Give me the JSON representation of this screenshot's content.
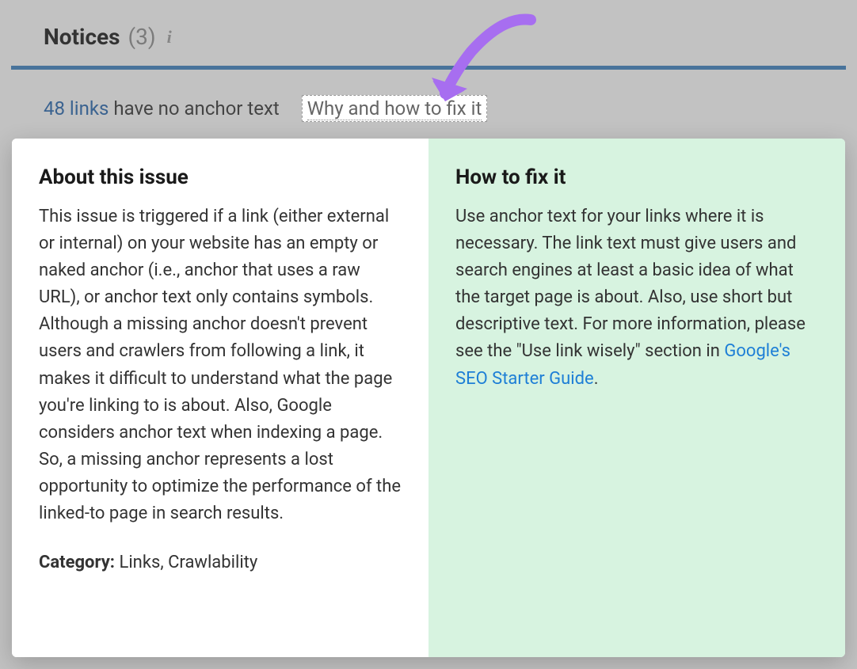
{
  "notices": {
    "title": "Notices",
    "count": "(3)"
  },
  "issue": {
    "link_text": "48 links",
    "suffix_text": " have no anchor text",
    "fixit_label": "Why and how to fix it"
  },
  "popup": {
    "about": {
      "heading": "About this issue",
      "body": "This issue is triggered if a link (either external or internal) on your website has an empty or naked anchor (i.e., anchor that uses a raw URL), or anchor text only contains symbols. Although a missing anchor doesn't prevent users and crawlers from following a link, it makes it difficult to understand what the page you're linking to is about. Also, Google considers anchor text when indexing a page. So, a missing anchor represents a lost opportunity to optimize the performance of the linked-to page in search results.",
      "category_label": "Category:",
      "category_value": " Links, Crawlability"
    },
    "fix": {
      "heading": "How to fix it",
      "body_prefix": "Use anchor text for your links where it is necessary. The link text must give users and search engines at least a basic idea of what the target page is about. Also, use short but descriptive text. For more information, please see the \"Use link wisely\" section in ",
      "link_text": "Google's SEO Starter Guide",
      "body_suffix": "."
    }
  }
}
